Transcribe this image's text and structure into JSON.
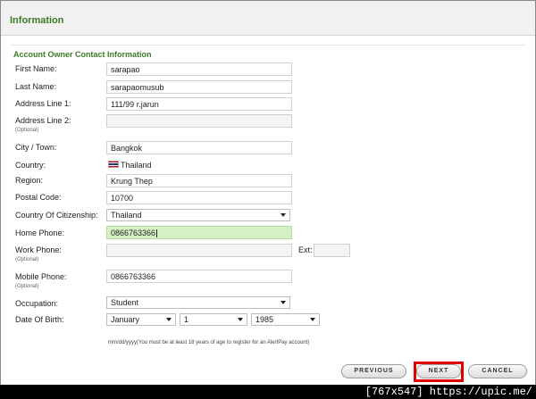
{
  "page": {
    "title": "Information"
  },
  "section": {
    "title": "Account Owner Contact Information"
  },
  "labels": {
    "first_name": "First Name:",
    "last_name": "Last Name:",
    "address1": "Address Line 1:",
    "address2": "Address Line 2:",
    "address2_sub": "(Optional)",
    "city": "City / Town:",
    "country": "Country:",
    "region": "Region:",
    "postal": "Postal Code:",
    "citizenship": "Country Of Citizenship:",
    "home_phone": "Home Phone:",
    "work_phone": "Work Phone:",
    "work_phone_sub": "(Optional)",
    "ext": "Ext:",
    "mobile_phone": "Mobile Phone:",
    "mobile_phone_sub": "(Optional)",
    "occupation": "Occupation:",
    "dob": "Date Of Birth:"
  },
  "values": {
    "first_name": "sarapao",
    "last_name": "sarapaomusub",
    "address1": "111/99 r.jarun",
    "address2": "",
    "city": "Bangkok",
    "country": "Thailand",
    "region": "Krung Thep",
    "postal": "10700",
    "citizenship": "Thailand",
    "home_phone": "0866763366",
    "work_phone": "",
    "ext": "",
    "mobile_phone": "0866763366",
    "occupation": "Student",
    "dob_month": "January",
    "dob_day": "1",
    "dob_year": "1985"
  },
  "dob_note": "mm/dd/yyyy(You must be at least 18 years of age to register for an AlertPay account)",
  "buttons": {
    "previous": "PREVIOUS",
    "next": "NEXT",
    "cancel": "CANCEL"
  },
  "footer": {
    "text": "[767x547] https://upic.me/"
  },
  "icons": {
    "country_flag": "thailand-flag-icon"
  },
  "colors": {
    "accent": "#3d7a26",
    "focus_field": "#d6f0c4",
    "highlight": "#e00000"
  }
}
